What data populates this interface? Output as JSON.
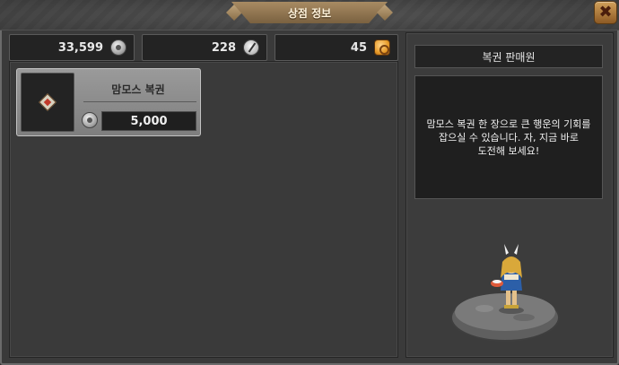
{
  "window": {
    "title": "상점 정보",
    "close_symbol": "✖"
  },
  "currencies": [
    {
      "value": "33,599",
      "icon": "silver-gear-coin-icon"
    },
    {
      "value": "228",
      "icon": "compass-token-icon"
    },
    {
      "value": "45",
      "icon": "gold-coin-bag-icon"
    }
  ],
  "shop_items": [
    {
      "name": "맘모스 복권",
      "price": "5,000",
      "icon": "lottery-ticket-icon",
      "price_icon": "silver-gear-coin-icon"
    }
  ],
  "vendor": {
    "title": "복권 판매원",
    "description_lines": [
      "맘모스 복권 한 장으로 큰 행운의 기회를",
      "잡으실 수 있습니다. 자, 지금 바로",
      "도전해 보세요!"
    ]
  },
  "colors": {
    "title_tab": "#8f7350",
    "close_button": "#b07a3a",
    "card": "#8c8c8c"
  }
}
